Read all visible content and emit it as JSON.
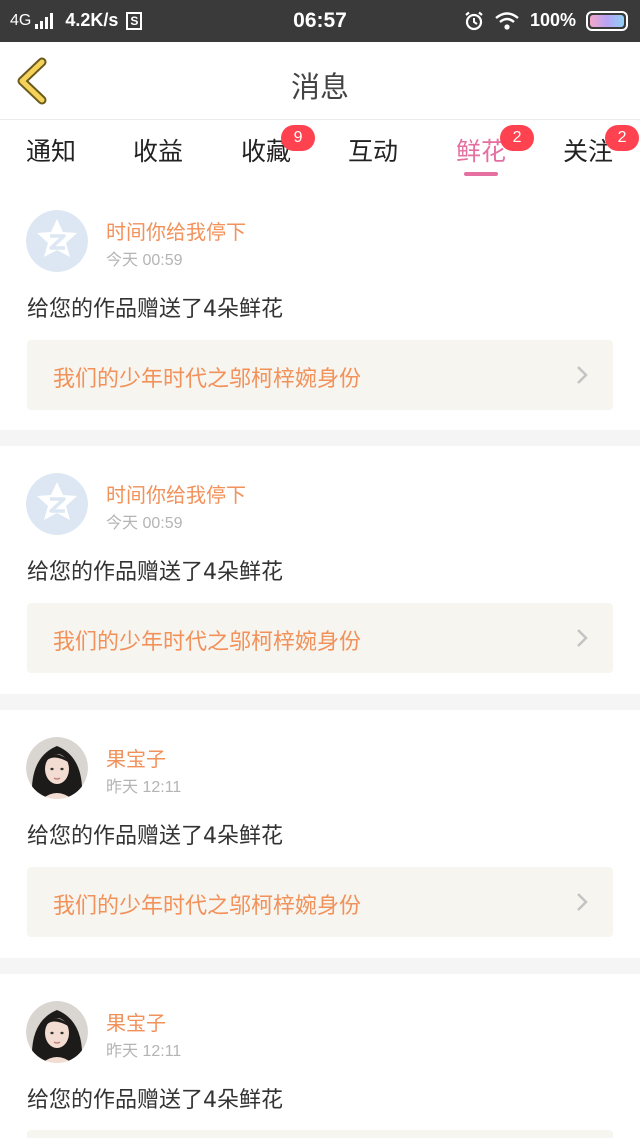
{
  "status_bar": {
    "network": "4G",
    "speed": "4.2K/s",
    "s_icon": "S",
    "time": "06:57",
    "battery": "100%"
  },
  "header": {
    "title": "消息",
    "back_icon": "chevron-left-icon"
  },
  "tabs": [
    {
      "label": "通知",
      "badge": ""
    },
    {
      "label": "收益",
      "badge": ""
    },
    {
      "label": "收藏",
      "badge": "9"
    },
    {
      "label": "互动",
      "badge": ""
    },
    {
      "label": "鲜花",
      "badge": "2",
      "active": true
    },
    {
      "label": "关注",
      "badge": "2"
    }
  ],
  "messages": [
    {
      "user": "时间你给我停下",
      "time": "今天 00:59",
      "text": "给您的作品赠送了4朵鲜花",
      "work": "我们的少年时代之邬柯梓婉身份",
      "avatar": "default-avatar"
    },
    {
      "user": "时间你给我停下",
      "time": "今天 00:59",
      "text": "给您的作品赠送了4朵鲜花",
      "work": "我们的少年时代之邬柯梓婉身份",
      "avatar": "default-avatar"
    },
    {
      "user": "果宝子",
      "time": "昨天 12:11",
      "text": "给您的作品赠送了4朵鲜花",
      "work": "我们的少年时代之邬柯梓婉身份",
      "avatar": "photo-avatar"
    },
    {
      "user": "果宝子",
      "time": "昨天 12:11",
      "text": "给您的作品赠送了4朵鲜花",
      "work": "",
      "avatar": "photo-avatar"
    }
  ],
  "colors": {
    "accent_pink": "#e46fa0",
    "name_orange": "#f2915a",
    "badge_red": "#ff4250",
    "back_yellow": "#f5d25a"
  }
}
